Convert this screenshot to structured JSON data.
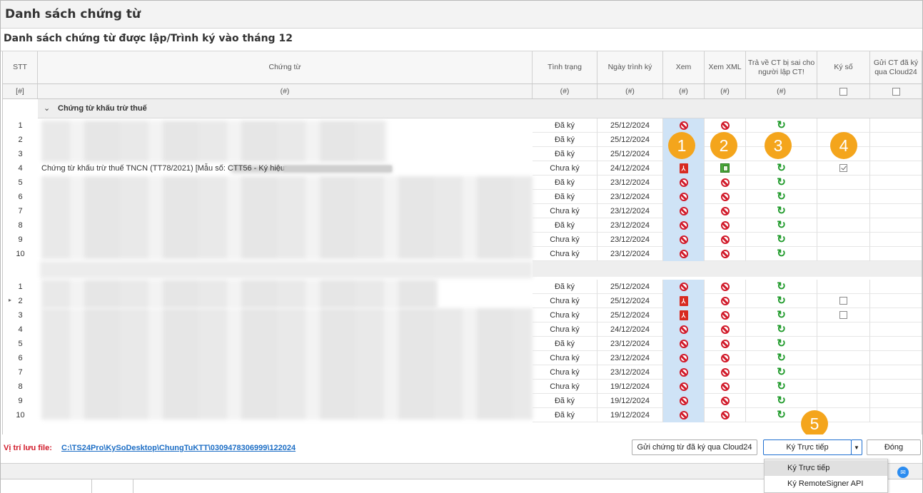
{
  "window_title": "Danh sách chứng từ",
  "subtitle": "Danh sách chứng từ được lập/Trình ký vào tháng 12",
  "columns": {
    "stt": "STT",
    "chung_tu": "Chứng từ",
    "tinh_trang": "Tình trạng",
    "ngay_trinh_ky": "Ngày trình ký",
    "xem": "Xem",
    "xem_xml": "Xem XML",
    "tra_ve": "Trả về CT bị sai cho người lập CT!",
    "ky_so": "Ký số",
    "gui_ct": "Gửi CT đã ký qua Cloud24"
  },
  "filter": {
    "stt": "[#]",
    "hash": "(#)"
  },
  "group1": {
    "label": "Chứng từ khấu trừ thuế",
    "rows": [
      {
        "stt": "1",
        "doc": "",
        "status": "Đã ký",
        "date": "25/12/2024",
        "xem": "ban",
        "xml": "ban",
        "ky": ""
      },
      {
        "stt": "2",
        "doc": "",
        "status": "Đã ký",
        "date": "25/12/2024",
        "xem": "ban",
        "xml": "ban",
        "ky": ""
      },
      {
        "stt": "3",
        "doc": "",
        "status": "Đã ký",
        "date": "25/12/2024",
        "xem": "ban",
        "xml": "ban",
        "ky": ""
      },
      {
        "stt": "4",
        "doc": "Chứng từ khấu trừ thuế TNCN (TT78/2021) [Mẫu số: CTT56 - Ký hiệu:",
        "status": "Chưa ký",
        "date": "24/12/2024",
        "xem": "pdf",
        "xml": "xml",
        "ky": "checked"
      },
      {
        "stt": "5",
        "doc": "",
        "status": "Đã ký",
        "date": "23/12/2024",
        "xem": "ban",
        "xml": "ban",
        "ky": ""
      },
      {
        "stt": "6",
        "doc": "",
        "status": "Đã ký",
        "date": "23/12/2024",
        "xem": "ban",
        "xml": "ban",
        "ky": ""
      },
      {
        "stt": "7",
        "doc": "",
        "status": "Chưa ký",
        "date": "23/12/2024",
        "xem": "ban",
        "xml": "ban",
        "ky": ""
      },
      {
        "stt": "8",
        "doc": "",
        "status": "Đã ký",
        "date": "23/12/2024",
        "xem": "ban",
        "xml": "ban",
        "ky": ""
      },
      {
        "stt": "9",
        "doc": "",
        "status": "Chưa ký",
        "date": "23/12/2024",
        "xem": "ban",
        "xml": "ban",
        "ky": ""
      },
      {
        "stt": "10",
        "doc": "",
        "status": "Chưa ký",
        "date": "23/12/2024",
        "xem": "ban",
        "xml": "ban",
        "ky": ""
      }
    ]
  },
  "group2": {
    "rows": [
      {
        "stt": "1",
        "status": "Đã ký",
        "date": "25/12/2024",
        "xem": "ban",
        "xml": "ban",
        "ky": ""
      },
      {
        "stt": "2",
        "status": "Chưa ký",
        "date": "25/12/2024",
        "xem": "pdf",
        "xml": "ban",
        "ky": "unchecked"
      },
      {
        "stt": "3",
        "status": "Chưa ký",
        "date": "25/12/2024",
        "xem": "pdf",
        "xml": "ban",
        "ky": "unchecked"
      },
      {
        "stt": "4",
        "status": "Chưa ký",
        "date": "24/12/2024",
        "xem": "ban",
        "xml": "ban",
        "ky": ""
      },
      {
        "stt": "5",
        "status": "Đã ký",
        "date": "23/12/2024",
        "xem": "ban",
        "xml": "ban",
        "ky": ""
      },
      {
        "stt": "6",
        "status": "Chưa ký",
        "date": "23/12/2024",
        "xem": "ban",
        "xml": "ban",
        "ky": ""
      },
      {
        "stt": "7",
        "status": "Chưa ký",
        "date": "23/12/2024",
        "xem": "ban",
        "xml": "ban",
        "ky": ""
      },
      {
        "stt": "8",
        "status": "Chưa ký",
        "date": "19/12/2024",
        "xem": "ban",
        "xml": "ban",
        "ky": ""
      },
      {
        "stt": "9",
        "status": "Đã ký",
        "date": "19/12/2024",
        "xem": "ban",
        "xml": "ban",
        "ky": ""
      },
      {
        "stt": "10",
        "status": "Đã ký",
        "date": "19/12/2024",
        "xem": "ban",
        "xml": "ban",
        "ky": ""
      }
    ]
  },
  "badges": [
    "1",
    "2",
    "3",
    "4",
    "5"
  ],
  "footer": {
    "path_label": "Vị trí lưu file:",
    "path": "C:\\TS24Pro\\KySoDesktop\\ChungTuKTT\\0309478306999\\122024",
    "send_button": "Gửi chứng từ đã ký qua Cloud24",
    "sign_button": "Ký Trực tiếp",
    "close_button": "Đóng"
  },
  "dropdown": {
    "items": [
      "Ký Trực tiếp",
      "Ký RemoteSigner API"
    ]
  },
  "colors": {
    "accent": "#f4a51c",
    "xem_column": "#cfe3f6",
    "link": "#1d6ec5",
    "label_red": "#d11a2a"
  }
}
